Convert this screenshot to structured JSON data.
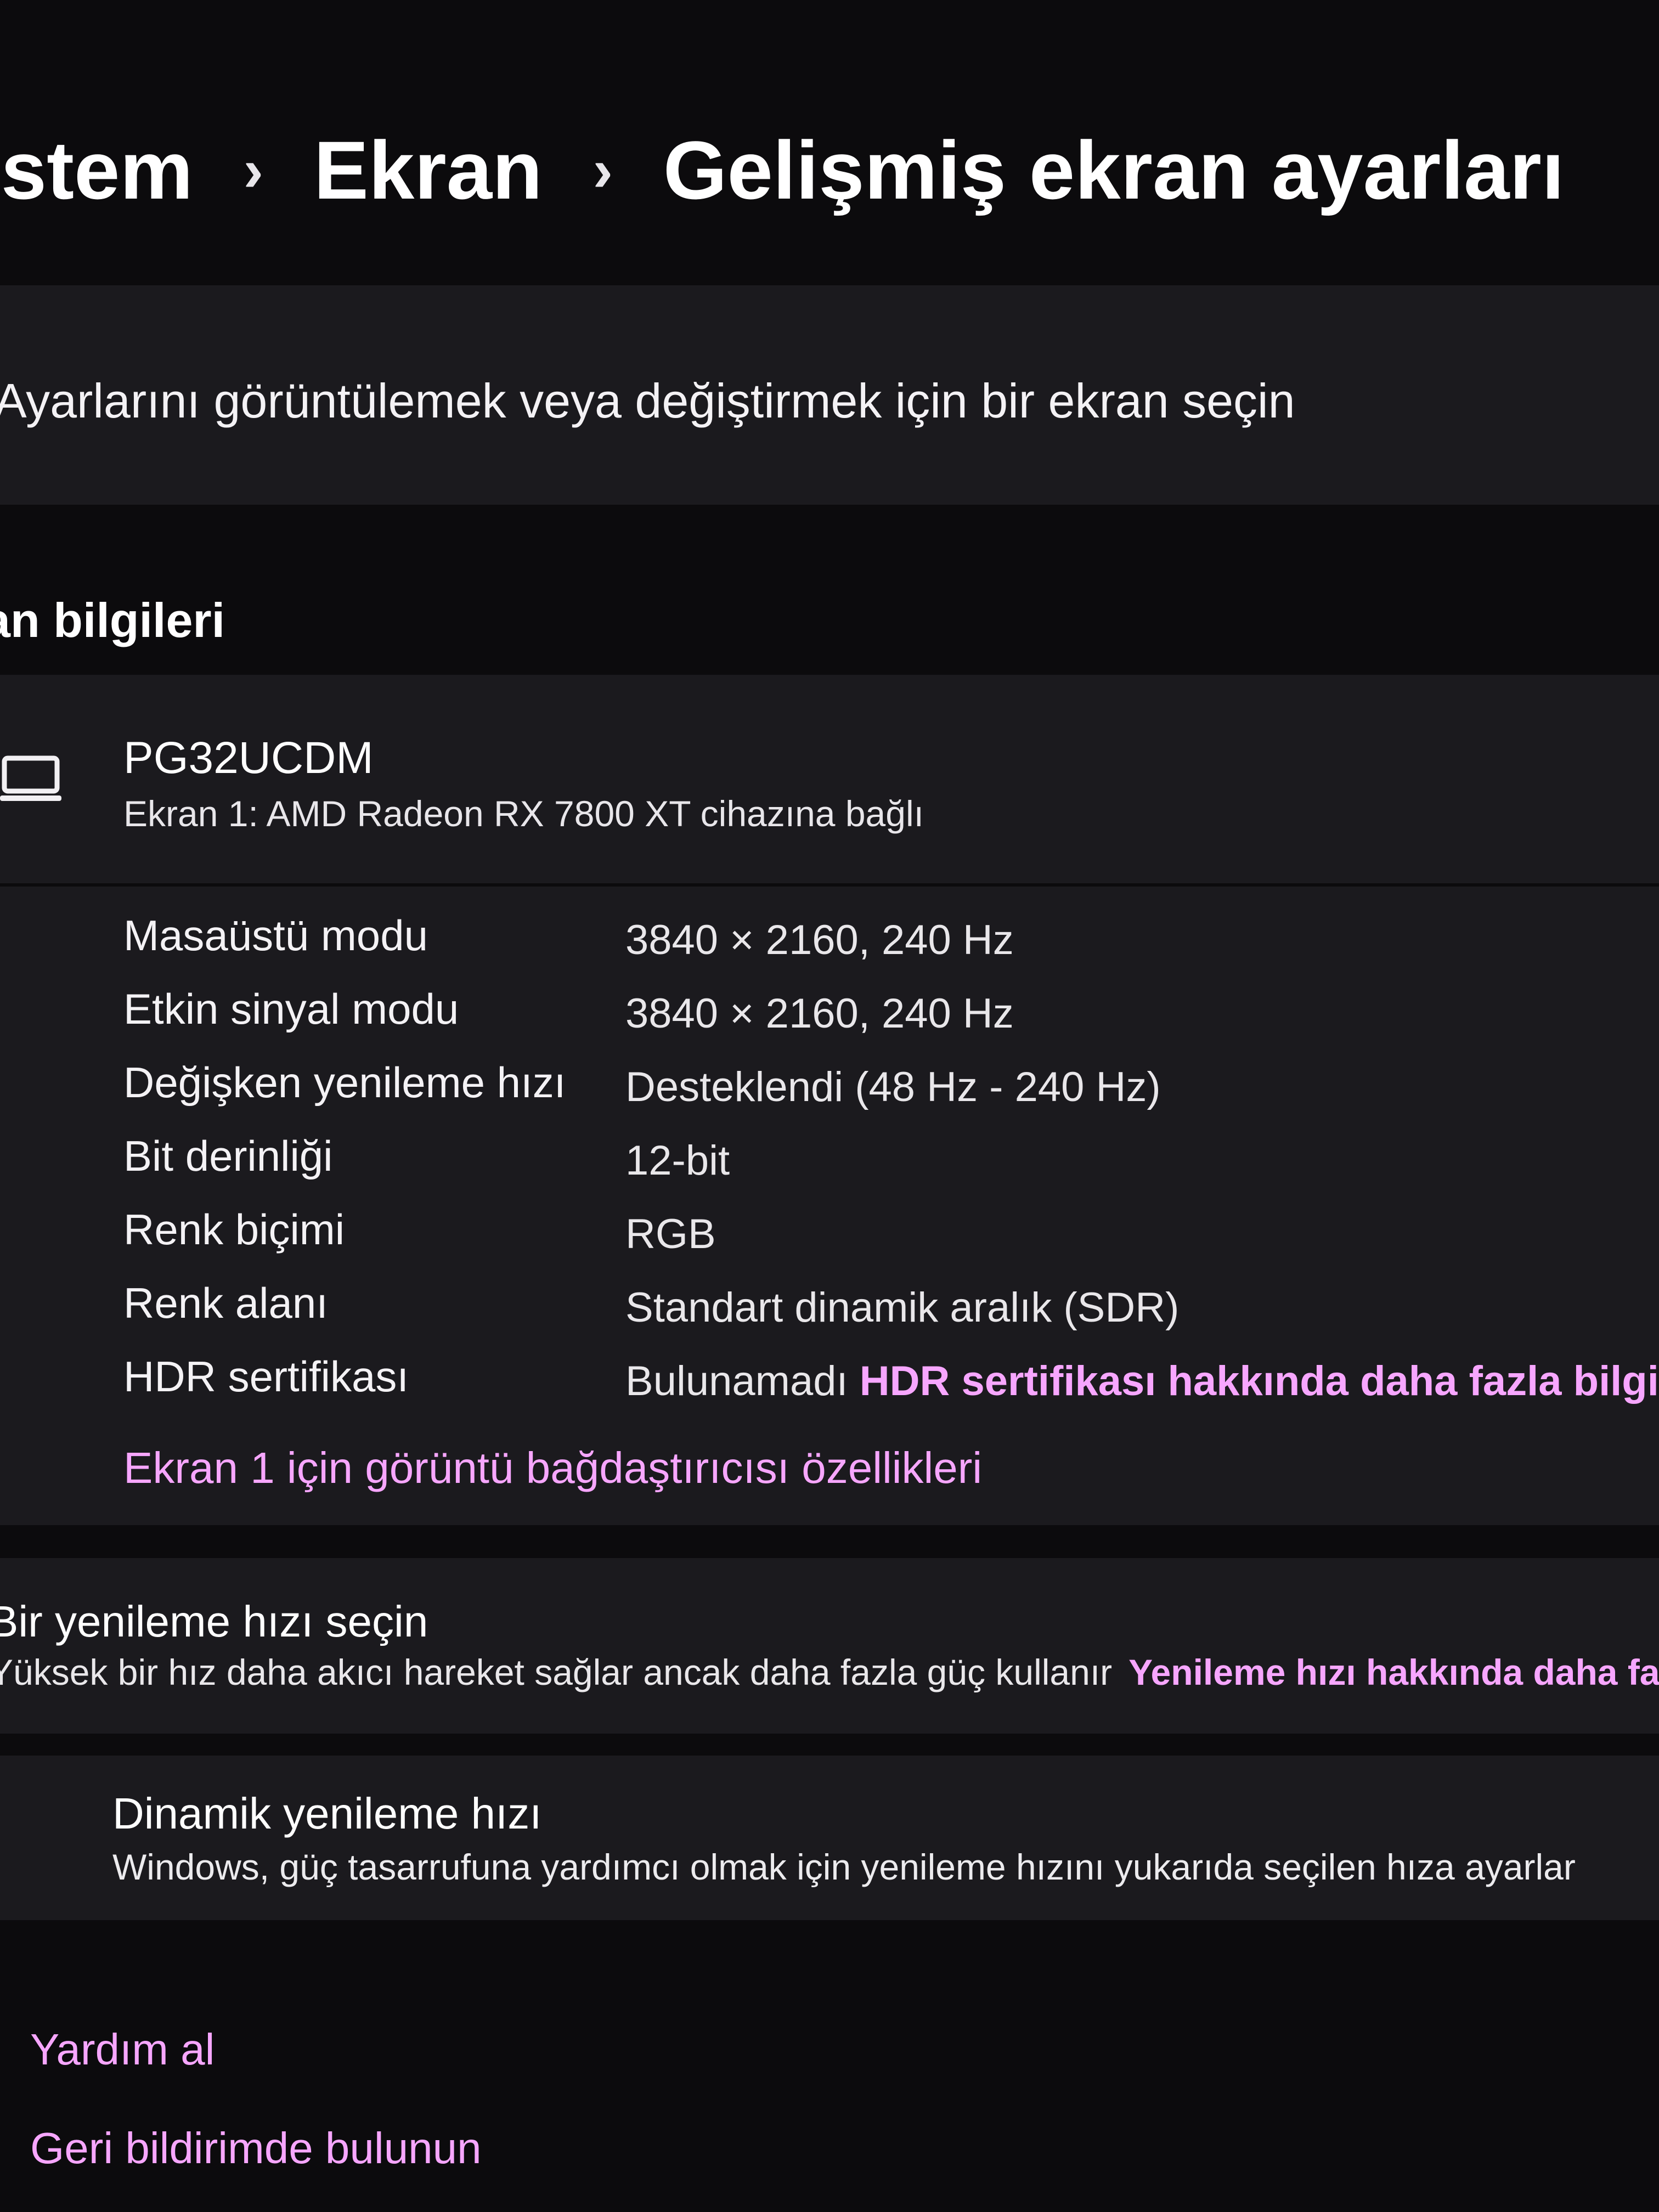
{
  "breadcrumb": {
    "items": [
      "istem",
      "Ekran",
      "Gelişmiş ekran ayarları"
    ],
    "separator": "›"
  },
  "select_display": {
    "text": "Ayarlarını görüntülemek veya değiştirmek için bir ekran seçin"
  },
  "display_info": {
    "section_title": "an bilgileri",
    "icon": "laptop-icon",
    "monitor_name": "PG32UCDM",
    "monitor_subtitle": "Ekran 1: AMD Radeon RX 7800 XT cihazına bağlı",
    "properties": [
      {
        "label": "Masaüstü modu",
        "value": "3840 × 2160, 240 Hz"
      },
      {
        "label": "Etkin sinyal modu",
        "value": "3840 × 2160, 240 Hz"
      },
      {
        "label": "Değişken yenileme hızı",
        "value": "Desteklendi (48 Hz - 240 Hz)"
      },
      {
        "label": "Bit derinliği",
        "value": "12-bit"
      },
      {
        "label": "Renk biçimi",
        "value": "RGB"
      },
      {
        "label": "Renk alanı",
        "value": "Standart dinamik aralık (SDR)"
      },
      {
        "label": "HDR sertifikası",
        "value": "Bulunamadı",
        "link": "HDR sertifikası hakkında daha fazla bilgi"
      }
    ],
    "adapter_link": "Ekran 1 için görüntü bağdaştırıcısı özellikleri"
  },
  "refresh_rate": {
    "title": "Bir yenileme hızı seçin",
    "subtitle": "Yüksek bir hız daha akıcı hareket sağlar ancak daha fazla güç kullanır",
    "link": "Yenileme hızı hakkında daha fazla"
  },
  "dynamic_refresh": {
    "title": "Dinamik yenileme hızı",
    "subtitle": "Windows, güç tasarrufuna yardımcı olmak için yenileme hızını yukarıda seçilen hıza ayarlar"
  },
  "footer": {
    "help": "Yardım al",
    "feedback": "Geri bildirimde bulunun"
  },
  "colors": {
    "background": "#0c0b0d",
    "card": "#1b1a1e",
    "accent_link": "#f7a6ff"
  }
}
